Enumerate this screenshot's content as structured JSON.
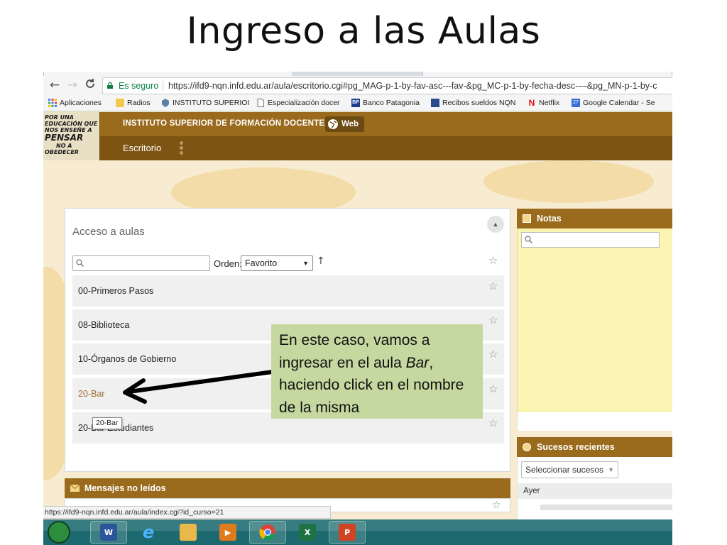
{
  "slide": {
    "title": "Ingreso a las Aulas"
  },
  "browser": {
    "nav": {
      "back_glyph": "←",
      "forward_glyph": "→",
      "reload_glyph": "C"
    },
    "secure_label": "Es seguro",
    "url": "https://ifd9-nqn.infd.edu.ar/aula/escritorio.cgi#pg_MAG-p-1-by-fav-asc---fav-&pg_MC-p-1-by-fecha-desc----&pg_MN-p-1-by-c",
    "bookmarks": [
      {
        "label": "Aplicaciones",
        "icon": "apps-grid-icon"
      },
      {
        "label": "Radios",
        "icon": "folder-icon"
      },
      {
        "label": "INSTITUTO SUPERIOI",
        "icon": "shield-icon"
      },
      {
        "label": "Especialización docer",
        "icon": "page-icon"
      },
      {
        "label": "Banco Patagonia",
        "icon": "bp-icon",
        "badge": "BP"
      },
      {
        "label": "Recibos sueldos NQN",
        "icon": "recibos-icon"
      },
      {
        "label": "Netflix",
        "icon": "netflix-icon",
        "badge": "N"
      },
      {
        "label": "Google Calendar - Se",
        "icon": "calendar-icon",
        "badge": "27"
      }
    ]
  },
  "site": {
    "logo_lines": [
      "POR UNA",
      "EDUCACIÓN QUE",
      "NOS ENSEÑE A",
      "PENSAR",
      "NO A",
      "OBEDECER"
    ],
    "institution": "INSTITUTO SUPERIOR DE FORMACIÓN DOCENTE N° 9",
    "web_label": "Web",
    "nav_item": "Escritorio"
  },
  "aulas": {
    "title": "Acceso a aulas",
    "collapse_glyph": "▲",
    "orden_label": "Orden:",
    "orden_value": "Favorito",
    "sort_glyph": "↑",
    "star_glyph": "☆",
    "courses": [
      {
        "name": "00-Primeros Pasos"
      },
      {
        "name": "08-Biblioteca"
      },
      {
        "name": "10-Órganos de Gobierno"
      },
      {
        "name": "20-Bar"
      },
      {
        "name": "20-Bar Estudiantes"
      }
    ],
    "tooltip": "20-Bar"
  },
  "callout": {
    "text_before": "En este caso, vamos a ingresar en el aula ",
    "text_italic": "Bar",
    "text_after": ", haciendo click en el nombre de la misma"
  },
  "sidebar": {
    "notas_title": "Notas",
    "sucesos_title": "Sucesos recientes",
    "sucesos_select": "Seleccionar sucesos",
    "ayer_label": "Ayer"
  },
  "mensajes": {
    "title": "Mensajes no leídos"
  },
  "status_url": "https://ifd9-nqn.infd.edu.ar/aula/index.cgi?id_curso=21",
  "taskbar": {
    "items": [
      {
        "name": "word-icon",
        "label": "W",
        "color": "#2b579a"
      },
      {
        "name": "ie-icon",
        "label": "e",
        "color": "#1e90ff"
      },
      {
        "name": "explorer-icon",
        "label": "",
        "color": "#e8b84a"
      },
      {
        "name": "media-player-icon",
        "label": "▶",
        "color": "#e07a1f"
      },
      {
        "name": "chrome-icon",
        "label": "",
        "color": "#db4437"
      },
      {
        "name": "excel-icon",
        "label": "X",
        "color": "#1f7244"
      },
      {
        "name": "powerpoint-icon",
        "label": "P",
        "color": "#d04423"
      }
    ]
  },
  "colors": {
    "header_brown": "#9a6a1d",
    "nav_brown": "#7e5413",
    "callout_green": "#c4d8a0",
    "notes_yellow": "#fbf5b3",
    "active_link": "#a0703a"
  }
}
